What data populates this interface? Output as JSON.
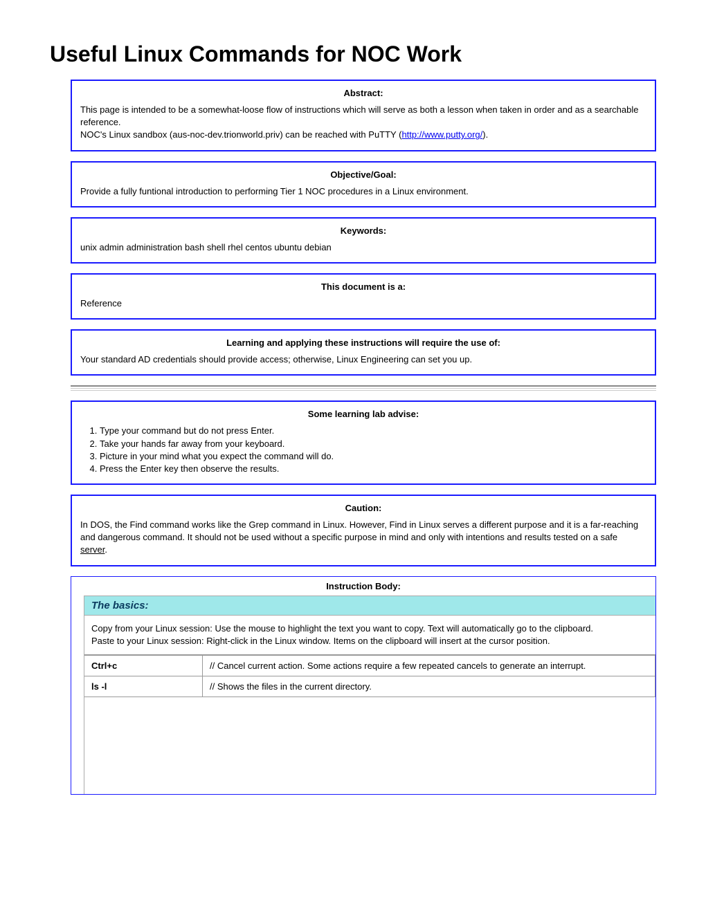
{
  "title": "Useful Linux Commands for NOC Work",
  "abstract": {
    "header": "Abstract:",
    "line1": "This page is intended to be a somewhat-loose flow of instructions which will serve as both a lesson when taken in order and as a searchable reference.",
    "line2a": "NOC's Linux sandbox (aus-noc-dev.trionworld.priv) can be reached with PuTTY (",
    "link": "http://www.putty.org/",
    "line2b": ")."
  },
  "objective": {
    "header": "Objective/Goal:",
    "body": "Provide a fully funtional introduction to performing Tier 1 NOC procedures in a Linux environment."
  },
  "keywords": {
    "header": "Keywords:",
    "body": "unix admin administration bash shell rhel centos ubuntu debian"
  },
  "doctype": {
    "header": "This document is a:",
    "body": "Reference"
  },
  "requirements": {
    "header": "Learning and applying these instructions will require the use of:",
    "body": "Your standard AD credentials should provide access; otherwise, Linux Engineering can set you up."
  },
  "advice": {
    "header": "Some learning lab advise:",
    "items": [
      "Type your command but do not press Enter.",
      "Take your hands far away from your keyboard.",
      "Picture in your mind what you expect the command will do.",
      "Press the Enter key then observe the results."
    ]
  },
  "caution": {
    "header": "Caution:",
    "body_a": "In DOS, the Find command works like the Grep command in Linux. However, Find in Linux serves a different purpose and it is a far-reaching and dangerous command. It should not be used without a specific purpose in mind and only with intentions and results tested on a safe ",
    "body_server": "server",
    "body_b": "."
  },
  "instruction": {
    "header": "Instruction Body:",
    "basics_title": "The basics:",
    "basics_intro1": "Copy from your Linux session: Use the mouse to highlight the text you want to copy. Text will automatically go to the clipboard.",
    "basics_intro2": "Paste to your Linux session: Right-click in the Linux window. Items on the clipboard will insert at the cursor position.",
    "commands": [
      {
        "cmd": "Ctrl+c",
        "desc": "// Cancel current action. Some actions require a few repeated cancels to generate an interrupt."
      },
      {
        "cmd": "ls -l",
        "desc": "// Shows the files in the current directory."
      }
    ]
  }
}
